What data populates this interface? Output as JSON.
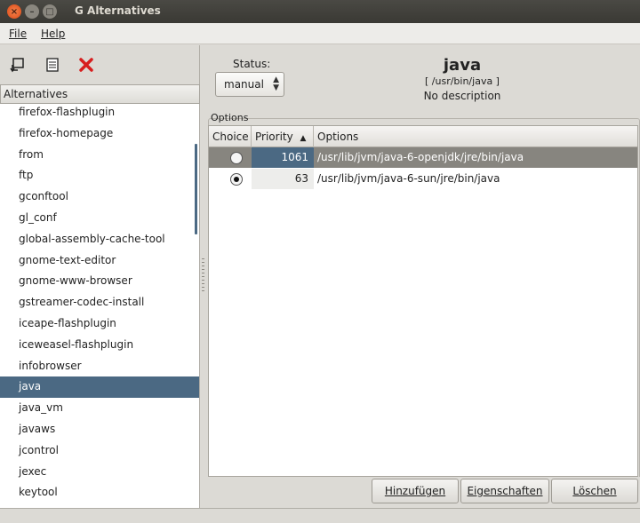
{
  "window": {
    "title": "G Alternatives"
  },
  "menu": {
    "items": [
      "File",
      "Help"
    ]
  },
  "toolbar": {
    "icons": [
      "properties-icon",
      "details-icon",
      "delete-icon"
    ],
    "delete_color": "#d71e1e"
  },
  "sidebar": {
    "header": "Alternatives",
    "items": [
      "firefox-flashplugin",
      "firefox-homepage",
      "from",
      "ftp",
      "gconftool",
      "gl_conf",
      "global-assembly-cache-tool",
      "gnome-text-editor",
      "gnome-www-browser",
      "gstreamer-codec-install",
      "iceape-flashplugin",
      "iceweasel-flashplugin",
      "infobrowser",
      "java",
      "java_vm",
      "javaws",
      "jcontrol",
      "jexec",
      "keytool"
    ],
    "selected_index": 13
  },
  "detail": {
    "status_label": "Status:",
    "status_value": "manual",
    "name": "java",
    "path": "[ /usr/bin/java ]",
    "description": "No description"
  },
  "options": {
    "group_label": "Options",
    "columns": [
      "Choice",
      "Priority",
      "Options"
    ],
    "sort_indicator": "▲",
    "rows": [
      {
        "choice": false,
        "priority": "1061",
        "path": "/usr/lib/jvm/java-6-openjdk/jre/bin/java",
        "selected": true
      },
      {
        "choice": true,
        "priority": "63",
        "path": "/usr/lib/jvm/java-6-sun/jre/bin/java",
        "selected": false
      }
    ]
  },
  "buttons": {
    "add": "Hinzufügen",
    "properties": "Eigenschaften",
    "delete": "Löschen"
  },
  "colors": {
    "selection": "#4b6983",
    "titlebar": "#3c3b37",
    "close": "#dd4814"
  }
}
